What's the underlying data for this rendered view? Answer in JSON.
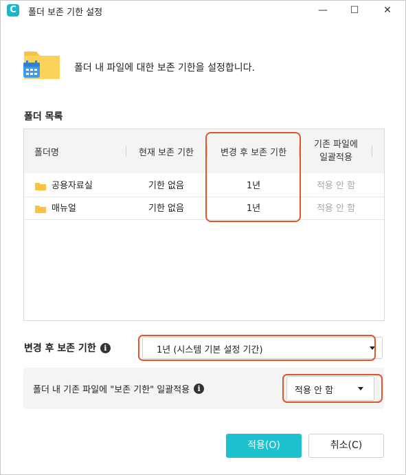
{
  "window": {
    "title": "폴더 보존 기한 설정",
    "controls": {
      "minimize": "—",
      "maximize": "☐",
      "close": "✕"
    }
  },
  "intro": {
    "text": "폴더 내 파일에 대한 보존 기한을 설정합니다."
  },
  "folder_list": {
    "label": "폴더 목록",
    "columns": [
      "폴더명",
      "현재 보존 기한",
      "변경 후 보존 기한",
      "기존 파일에",
      "일괄적용"
    ],
    "rows": [
      {
        "name": "공용자료실",
        "current": "기한 없음",
        "after": "1년",
        "apply": "적용 안 함"
      },
      {
        "name": "매뉴얼",
        "current": "기한 없음",
        "after": "1년",
        "apply": "적용 안 함"
      }
    ]
  },
  "retention": {
    "label": "변경 후 보존 기한",
    "selected": "1년 (시스템 기본 설정 기간)"
  },
  "bulk_apply": {
    "label": "폴더 내 기존 파일에 \"보존 기한\" 일괄적용",
    "selected": "적용 안 함"
  },
  "buttons": {
    "apply": "적용(O)",
    "cancel": "취소(C)"
  },
  "colors": {
    "accent": "#1ec2cf",
    "highlight": "#e2542a",
    "folder": "#f6c343"
  }
}
